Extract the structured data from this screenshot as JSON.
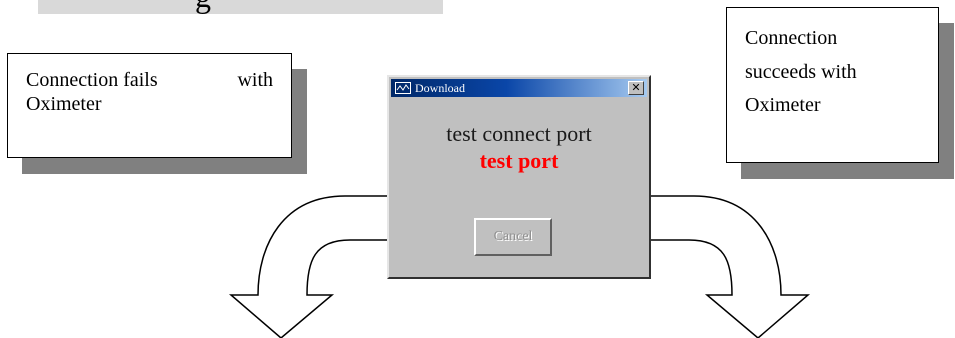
{
  "top_strip": {
    "partial_text": "g"
  },
  "callouts": {
    "left": {
      "line1_a": "Connection fails",
      "line1_b": "with",
      "line2": "Oximeter"
    },
    "right": {
      "lines": [
        "Connection",
        "succeeds with",
        "Oximeter"
      ]
    }
  },
  "dialog": {
    "title": "Download",
    "close_label": "✕",
    "message_line1": "test connect port",
    "message_line2": "test port",
    "cancel_label": "Cancel",
    "cancel_enabled": false,
    "message_line2_color": "#ff0000",
    "titlebar_color": "#0a46a8"
  },
  "arrows": {
    "left_direction": "down",
    "right_direction": "down",
    "icons": [
      "curved-arrow-left-icon",
      "curved-arrow-right-icon"
    ]
  }
}
